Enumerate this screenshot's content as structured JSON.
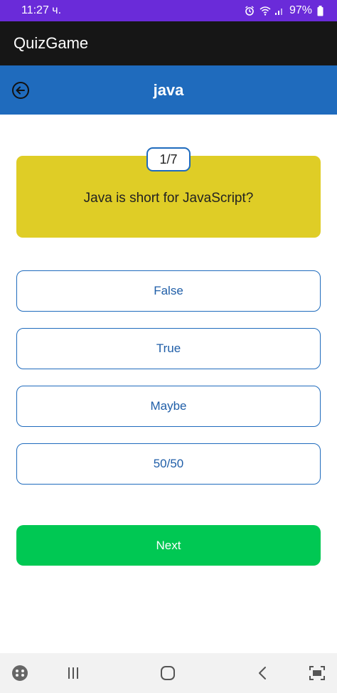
{
  "status_bar": {
    "time": "11:27 ч.",
    "battery": "97%",
    "icons": [
      "alarm-icon",
      "wifi-icon",
      "signal-icon",
      "battery-icon"
    ]
  },
  "app_bar": {
    "title": "QuizGame"
  },
  "topic_header": {
    "title": "java",
    "back_icon": "back-arrow-icon"
  },
  "question": {
    "counter": "1/7",
    "text": "Java is short for JavaScript?"
  },
  "answers": [
    {
      "label": "False"
    },
    {
      "label": "True"
    },
    {
      "label": "Maybe"
    },
    {
      "label": "50/50"
    }
  ],
  "next_button": {
    "label": "Next"
  },
  "nav_bar": {
    "icons": [
      "game-launcher-icon",
      "recent-apps-icon",
      "home-icon",
      "back-icon",
      "screen-capture-icon"
    ]
  },
  "colors": {
    "status_bar": "#6a2bd9",
    "app_bar": "#161616",
    "topic_header": "#1f6bbd",
    "question_card": "#dfcd26",
    "answer_border": "#1f6bbd",
    "next_button": "#00c853"
  }
}
